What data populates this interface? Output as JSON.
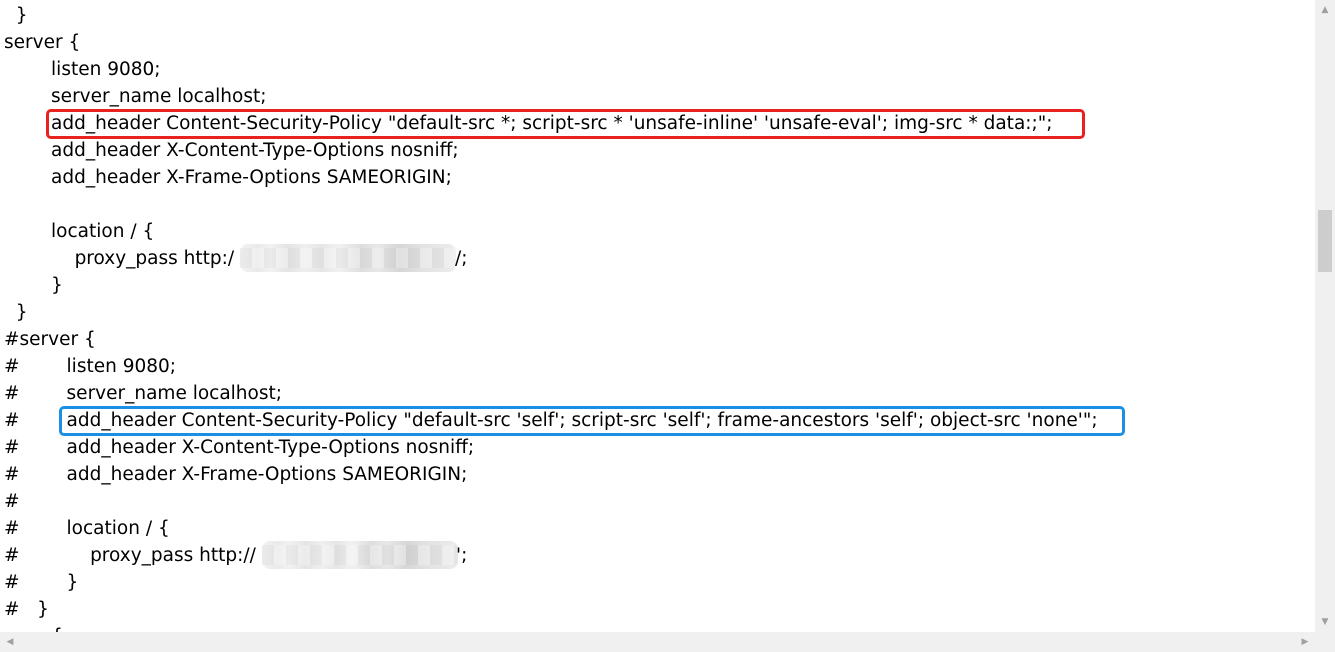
{
  "code_lines": [
    "  }",
    "server {",
    "        listen 9080;",
    "        server_name localhost;",
    "        add_header Content-Security-Policy \"default-src *; script-src * 'unsafe-inline' 'unsafe-eval'; img-src * data:;\";",
    "        add_header X-Content-Type-Options nosniff;",
    "        add_header X-Frame-Options SAMEORIGIN;",
    "",
    "        location / {",
    "            proxy_pass http:/",
    "        }",
    "  }",
    "#server {",
    "#        listen 9080;",
    "#        server_name localhost;",
    "#        add_header Content-Security-Policy \"default-src 'self'; script-src 'self'; frame-ancestors 'self'; object-src 'none'\";",
    "#        add_header X-Content-Type-Options nosniff;",
    "#        add_header X-Frame-Options SAMEORIGIN;",
    "#",
    "#        location / {",
    "#            proxy_pass http://",
    "#        }",
    "#   }",
    "        {"
  ],
  "redacted_suffix_1": "/;",
  "redacted_suffix_2": "';",
  "colors": {
    "highlight_red": "#e8221e",
    "highlight_blue": "#1a8fe3",
    "scrollbar_track": "#f0f0f0",
    "scrollbar_thumb": "#cdcdcd"
  },
  "scrollbar_icons": {
    "up": "▲",
    "down": "▼",
    "left": "◀",
    "right": "▶"
  }
}
